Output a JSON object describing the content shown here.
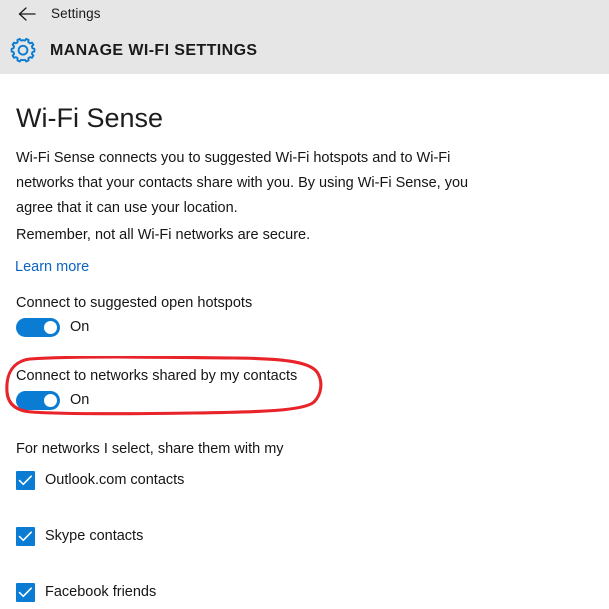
{
  "app_bar": {
    "back_icon": "back-arrow-icon",
    "title": "Settings"
  },
  "page_header": {
    "icon": "gear-icon",
    "title": "MANAGE WI-FI SETTINGS"
  },
  "main": {
    "section_title": "Wi-Fi Sense",
    "paragraph": "Wi-Fi Sense connects you to suggested Wi-Fi hotspots and to Wi-Fi networks that your contacts share with you. By using Wi-Fi Sense, you agree that it can use your location.",
    "note": "Remember, not all Wi-Fi networks are secure.",
    "learn_more": "Learn more",
    "toggles": [
      {
        "label": "Connect to suggested open hotspots",
        "state": "On",
        "checked": true
      },
      {
        "label": "Connect to networks shared by my contacts",
        "state": "On",
        "checked": true,
        "annotated": true
      }
    ],
    "share_label": "For networks I select, share them with my",
    "checkboxes": [
      {
        "label": "Outlook.com contacts",
        "checked": true
      },
      {
        "label": "Skype contacts",
        "checked": true
      },
      {
        "label": "Facebook friends",
        "checked": true
      }
    ]
  },
  "colors": {
    "accent_blue": "#0a7cd4",
    "link_blue": "#0b64c4",
    "chrome_gray": "#e6e6e6",
    "annotation_red": "#e8232a",
    "text": "#151515"
  }
}
